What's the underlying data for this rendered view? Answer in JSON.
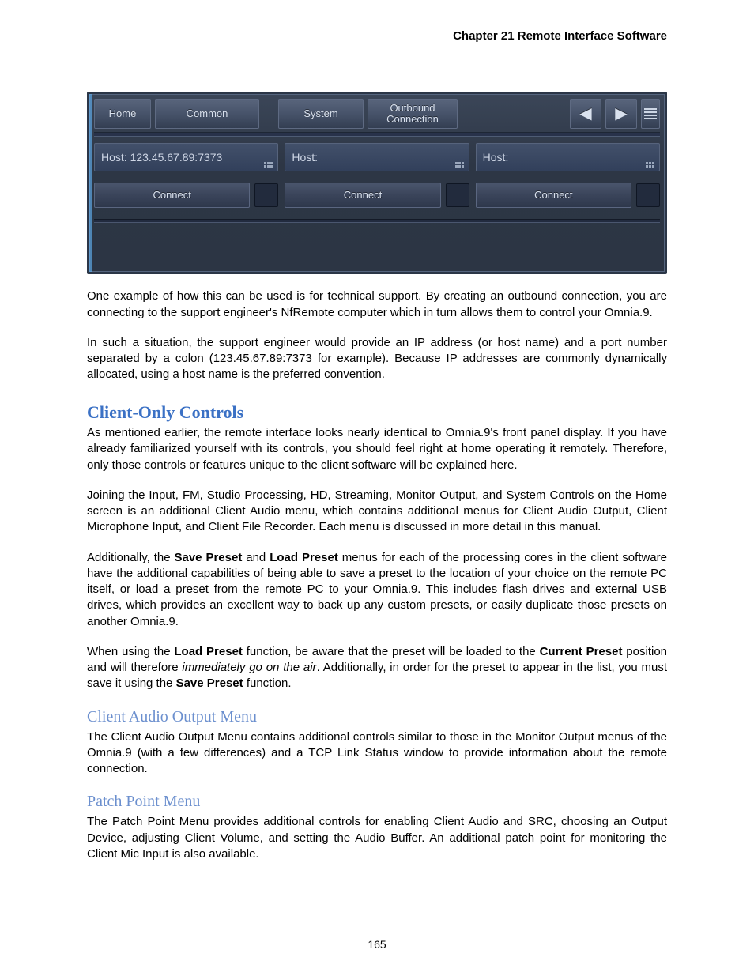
{
  "header": {
    "chapter": "Chapter 21  Remote Interface Software"
  },
  "ui": {
    "topbar": {
      "home": "Home",
      "common": "Common",
      "system": "System",
      "outbound": "Outbound\nConnection"
    },
    "hosts": [
      {
        "label": "Host: 123.45.67.89:7373",
        "connect": "Connect"
      },
      {
        "label": "Host:",
        "connect": "Connect"
      },
      {
        "label": "Host:",
        "connect": "Connect"
      }
    ]
  },
  "body": {
    "p1": "One example of how this can be used is for technical support. By creating an outbound connection, you are connecting to the support engineer's NfRemote computer which in turn allows them to control your Omnia.9.",
    "p2": "In such a situation, the support engineer would provide an IP address (or host name) and a port number separated by a colon (123.45.67.89:7373 for example). Because IP addresses are commonly dynamically allocated, using a host name is the preferred convention.",
    "h2a": "Client-Only Controls",
    "p3": "As mentioned earlier, the remote interface looks nearly identical to Omnia.9's front panel display. If you have already familiarized yourself with its controls, you should feel right at home operating it remotely. Therefore, only those controls or features unique to the client software will be explained here.",
    "p4": "Joining the Input, FM, Studio Processing, HD, Streaming, Monitor Output, and System Controls on the Home screen is an additional Client Audio menu, which contains additional menus for Client Audio Output, Client Microphone Input, and Client File Recorder. Each menu is discussed in more detail in this manual.",
    "p5_a": "Additionally, the ",
    "p5_b": "Save Preset",
    "p5_c": " and ",
    "p5_d": "Load Preset",
    "p5_e": " menus for each of the processing cores in the client software have the additional capabilities of being able to save a preset to the location of your choice on the remote PC itself, or load a preset from the remote PC to your Omnia.9. This includes flash drives and external USB drives, which provides an excellent way to back up any custom presets, or easily duplicate those presets on another Omnia.9.",
    "p6_a": "When using the ",
    "p6_b": "Load Preset",
    "p6_c": " function, be aware that the preset will be loaded to the ",
    "p6_d": "Current Preset",
    "p6_e": " position and will therefore ",
    "p6_f": "immediately go on the air",
    "p6_g": ". Additionally, in order for the preset to appear in the list, you must save it using the ",
    "p6_h": "Save Preset",
    "p6_i": " function.",
    "h3a": "Client Audio Output Menu",
    "p7": "The Client Audio Output Menu contains additional controls similar to those in the Monitor Output menus of the Omnia.9 (with a few differences) and a TCP Link Status window to provide information about the remote connection.",
    "h3b": "Patch Point Menu",
    "p8": "The Patch Point Menu provides additional controls for enabling Client Audio and SRC, choosing an Output Device, adjusting Client Volume, and setting the Audio Buffer. An additional patch point for monitoring the Client Mic Input is also available."
  },
  "page_number": "165"
}
